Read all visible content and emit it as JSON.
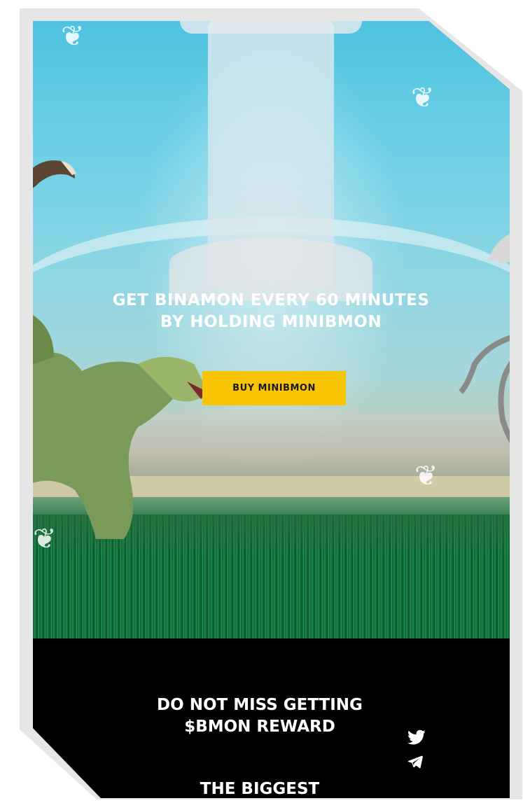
{
  "hero": {
    "heading": "GET BINAMON EVERY 60 MINUTES BY HOLDING MINIBMON",
    "button_label": "BUY MINIBMON"
  },
  "footer": {
    "heading": "DO NOT MISS GETTING $BMON REWARD",
    "subheading": "THE BIGGEST",
    "social": [
      {
        "icon": "twitter-icon"
      },
      {
        "icon": "telegram-icon"
      }
    ]
  },
  "colors": {
    "accent": "#f9c406",
    "footer_bg": "#000000",
    "sky": "#4fc3df",
    "grass": "#1a8a4a"
  }
}
